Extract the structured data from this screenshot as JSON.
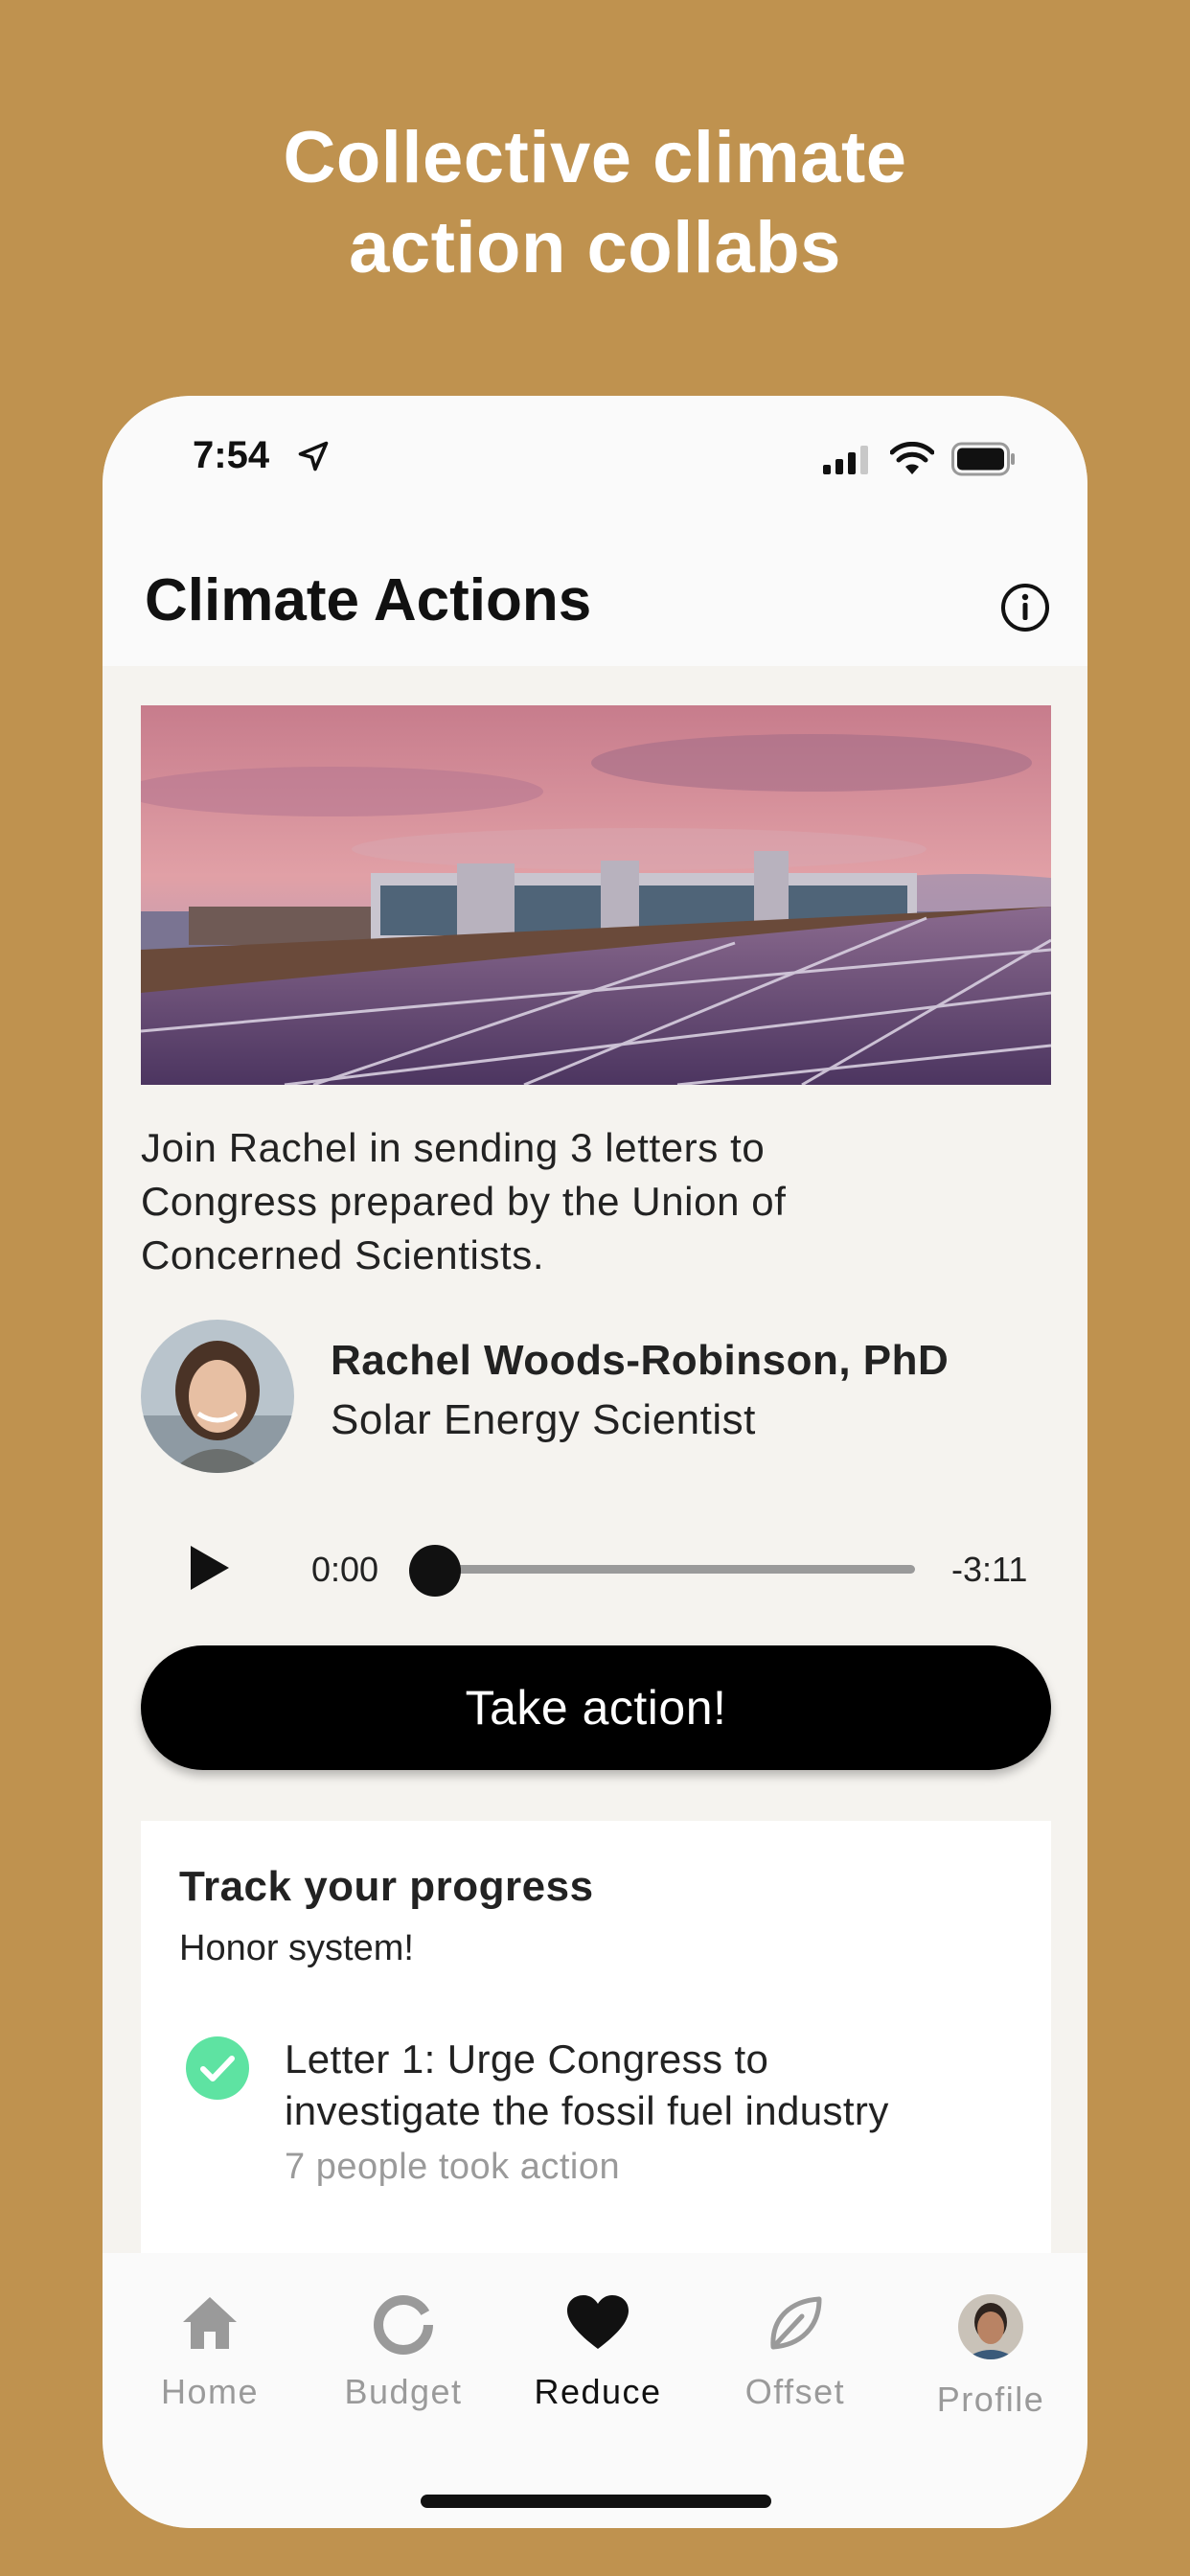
{
  "headline": {
    "line1": "Collective climate",
    "line2": "action collabs"
  },
  "status_bar": {
    "time": "7:54"
  },
  "header": {
    "title": "Climate Actions"
  },
  "action": {
    "description_lines": [
      "Join Rachel in sending 3 letters to",
      "Congress prepared by the Union of",
      "Concerned Scientists."
    ],
    "person": {
      "name": "Rachel Woods-Robinson, PhD",
      "role": "Solar Energy Scientist"
    },
    "audio": {
      "current_time": "0:00",
      "remaining_time": "-3:11",
      "progress": 0
    },
    "button_label": "Take action!"
  },
  "progress": {
    "title": "Track your progress",
    "subtitle": "Honor system!",
    "tasks": [
      {
        "title_lines": [
          "Letter 1: Urge Congress to",
          "investigate the fossil fuel industry"
        ],
        "count_text": "7 people took action",
        "completed": true
      }
    ]
  },
  "tab_bar": {
    "tabs": [
      {
        "label": "Home",
        "icon": "home-icon",
        "active": false
      },
      {
        "label": "Budget",
        "icon": "budget-ring-icon",
        "active": false
      },
      {
        "label": "Reduce",
        "icon": "heart-icon",
        "active": true
      },
      {
        "label": "Offset",
        "icon": "leaf-icon",
        "active": false
      },
      {
        "label": "Profile",
        "icon": "profile-avatar",
        "active": false
      }
    ]
  },
  "colors": {
    "background": "#BF924F",
    "check": "#5EE3A2",
    "button": "#000000",
    "muted_text": "#9A9A9A"
  }
}
